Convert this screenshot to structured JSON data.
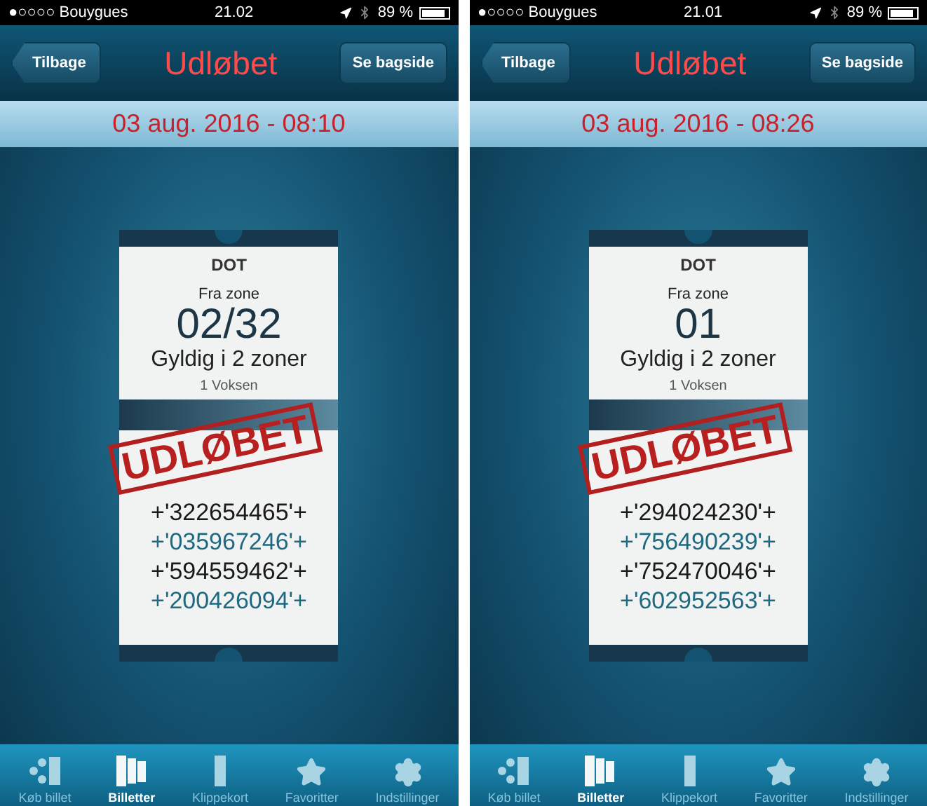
{
  "screens": [
    {
      "status_bar": {
        "carrier": "●○○○○ Bouygues",
        "time": "21.02",
        "battery": "89 %"
      },
      "nav": {
        "back": "Tilbage",
        "title": "Udløbet",
        "action": "Se bagside"
      },
      "date": "03 aug. 2016 - 08:10",
      "ticket": {
        "logo": "DOT",
        "from_label": "Fra zone",
        "zone": "02/32",
        "validity": "Gyldig i 2 zoner",
        "passengers": "1 Voksen",
        "stamp": "UDLØBET",
        "codes": [
          {
            "text": "+'322654465'+",
            "color": "#1a1a1a"
          },
          {
            "text": "+'035967246'+",
            "color": "#1f6a80"
          },
          {
            "text": "+'594559462'+",
            "color": "#1a1a1a"
          },
          {
            "text": "+'200426094'+",
            "color": "#1f6a80"
          }
        ]
      },
      "tabs": [
        {
          "label": "Køb billet",
          "kind": "buy",
          "selected": false
        },
        {
          "label": "Billetter",
          "kind": "tickets",
          "selected": true
        },
        {
          "label": "Klippekort",
          "kind": "card",
          "selected": false
        },
        {
          "label": "Favoritter",
          "kind": "star",
          "selected": false
        },
        {
          "label": "Indstillinger",
          "kind": "gear",
          "selected": false
        }
      ]
    },
    {
      "status_bar": {
        "carrier": "●○○○○ Bouygues",
        "time": "21.01",
        "battery": "89 %"
      },
      "nav": {
        "back": "Tilbage",
        "title": "Udløbet",
        "action": "Se bagside"
      },
      "date": "03 aug. 2016 - 08:26",
      "ticket": {
        "logo": "DOT",
        "from_label": "Fra zone",
        "zone": "01",
        "validity": "Gyldig i 2 zoner",
        "passengers": "1 Voksen",
        "stamp": "UDLØBET",
        "codes": [
          {
            "text": "+'294024230'+",
            "color": "#1a1a1a"
          },
          {
            "text": "+'756490239'+",
            "color": "#1f6a80"
          },
          {
            "text": "+'752470046'+",
            "color": "#1a1a1a"
          },
          {
            "text": "+'602952563'+",
            "color": "#1f6a80"
          }
        ]
      },
      "tabs": [
        {
          "label": "Køb billet",
          "kind": "buy",
          "selected": false
        },
        {
          "label": "Billetter",
          "kind": "tickets",
          "selected": true
        },
        {
          "label": "Klippekort",
          "kind": "card",
          "selected": false
        },
        {
          "label": "Favoritter",
          "kind": "star",
          "selected": false
        },
        {
          "label": "Indstillinger",
          "kind": "gear",
          "selected": false
        }
      ]
    }
  ]
}
